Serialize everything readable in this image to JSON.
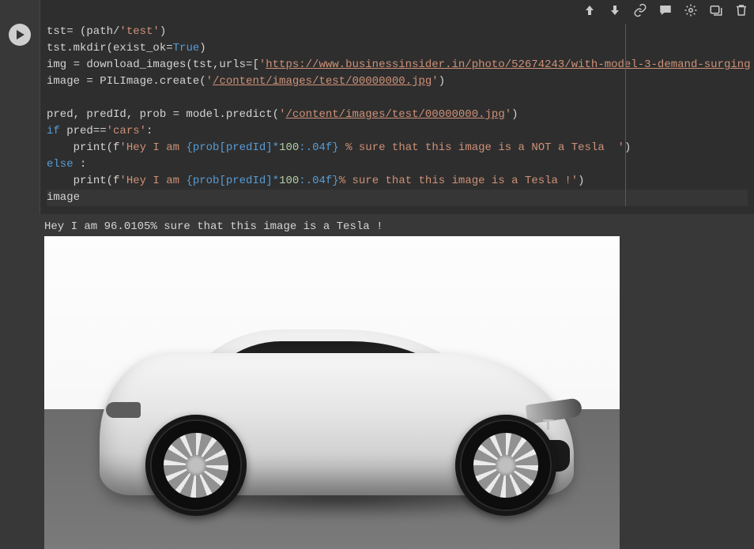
{
  "toolbar": {
    "items": [
      {
        "name": "move-up",
        "glyph": "↑"
      },
      {
        "name": "move-down",
        "glyph": "↓"
      },
      {
        "name": "link",
        "glyph": "link"
      },
      {
        "name": "comment",
        "glyph": "comment"
      },
      {
        "name": "settings",
        "glyph": "gear"
      },
      {
        "name": "mirror",
        "glyph": "mirror"
      },
      {
        "name": "delete",
        "glyph": "trash"
      }
    ]
  },
  "code": {
    "l1": {
      "a": "tst= (path/",
      "s": "'test'",
      "b": ")"
    },
    "l2": {
      "a": "tst.mkdir(exist_ok=",
      "k": "True",
      "b": ")"
    },
    "l3": {
      "a": "img = download_images(tst,urls=[",
      "s": "'",
      "u": "https://www.businessinsider.in/photo/52674243/with-model-3-demand-surging"
    },
    "l4": {
      "a": "image = PILImage.create(",
      "s1": "'",
      "u": "/content/images/test/00000000.jpg",
      "s2": "'",
      "b": ")"
    },
    "l5": "",
    "l6": {
      "a": "pred, predId, prob = model.predict(",
      "s1": "'",
      "u": "/content/images/test/00000000.jpg",
      "s2": "'",
      "b": ")"
    },
    "l7": {
      "k": "if",
      "a": " pred==",
      "s": "'cars'",
      "b": ":"
    },
    "l8": {
      "indent": "    ",
      "a": "print(f",
      "s1": "'Hey I am ",
      "f1": "{prob[predId]*",
      "n": "100",
      "f2": ":.04f}",
      "s2": " % sure that this image is a NOT a Tesla  '",
      "b": ")"
    },
    "l9": {
      "k": "else",
      "a": " :"
    },
    "l10": {
      "indent": "    ",
      "a": "print(f",
      "s1": "'Hey I am ",
      "f1": "{prob[predId]*",
      "n": "100",
      "f2": ":.04f}",
      "s2": "% sure that this image is a Tesla !'",
      "b": ")"
    },
    "l11": {
      "a": "image"
    }
  },
  "output": {
    "text": "Hey I am 96.0105% sure that this image is a Tesla !",
    "image_alt": "white Tesla Model S sedan on grey floor, white background"
  }
}
